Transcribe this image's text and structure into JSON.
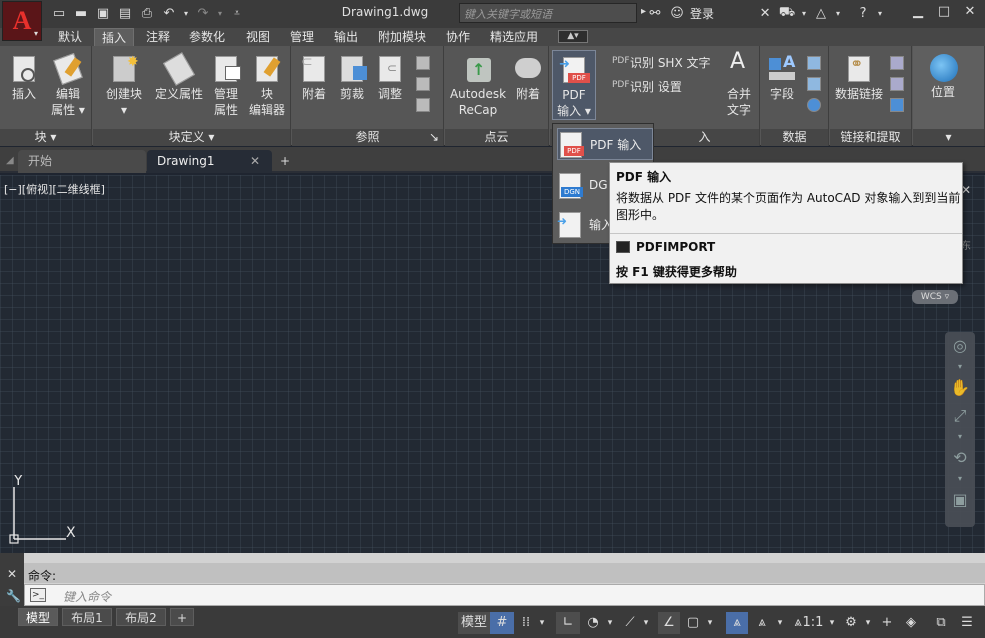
{
  "window": {
    "title": "Drawing1.dwg",
    "search_placeholder": "键入关键字或短语",
    "login": "登录"
  },
  "ribbon_tabs": [
    "默认",
    "插入",
    "注释",
    "参数化",
    "视图",
    "管理",
    "输出",
    "附加模块",
    "协作",
    "精选应用"
  ],
  "active_tab": "插入",
  "panels": {
    "block": {
      "title": "块",
      "insert": "插入",
      "edit_attr": [
        "编辑",
        "属性"
      ]
    },
    "block_def": {
      "title": "块定义",
      "create": "创建块",
      "define_attr": "定义属性",
      "manage_attr": [
        "管理",
        "属性"
      ],
      "block_editor": [
        "块",
        "编辑器"
      ]
    },
    "reference": {
      "title": "参照",
      "attach": "附着",
      "clip": "剪裁",
      "adjust": "调整"
    },
    "pointcloud": {
      "title": "点云",
      "recap": [
        "Autodesk",
        "ReCap"
      ],
      "attach": "附着"
    },
    "import": {
      "title": "入",
      "pdf_import": [
        "PDF",
        "输入"
      ],
      "recognize_shx": "识别 SHX 文字",
      "recognize_settings": "识别 设置",
      "merge_text": [
        "合并",
        "文字"
      ]
    },
    "data": {
      "title": "数据",
      "field": "字段"
    },
    "link": {
      "title": "链接和提取",
      "data_link": "数据链接"
    },
    "location": {
      "title": "",
      "location": "位置"
    }
  },
  "doc_tabs": [
    {
      "label": "开始"
    },
    {
      "label": "Drawing1"
    }
  ],
  "viewport_label": "[−][俯视][二维线框]",
  "wcs": "WCS",
  "ucs": {
    "y": "Y",
    "x": "X"
  },
  "dropdown": {
    "items": [
      {
        "label": "PDF 输入",
        "icon": "PDF"
      },
      {
        "label": "DG",
        "icon": "DGN"
      },
      {
        "label": "输入",
        "icon": ""
      }
    ]
  },
  "tooltip": {
    "title": "PDF 输入",
    "description": "将数据从 PDF 文件的某个页面作为 AutoCAD 对象输入到到当前图形中。",
    "command": "PDFIMPORT",
    "help": "按 F1 键获得更多帮助"
  },
  "command": {
    "history": "命令:",
    "placeholder": "键入命令"
  },
  "layout_tabs": [
    "模型",
    "布局1",
    "布局2"
  ],
  "status": {
    "model": "模型",
    "scale": "1:1"
  },
  "canvas_right_partial": "东",
  "colors": {
    "accent": "#4e7fc7",
    "app_red": "#e8302c",
    "canvas": "#222933"
  }
}
